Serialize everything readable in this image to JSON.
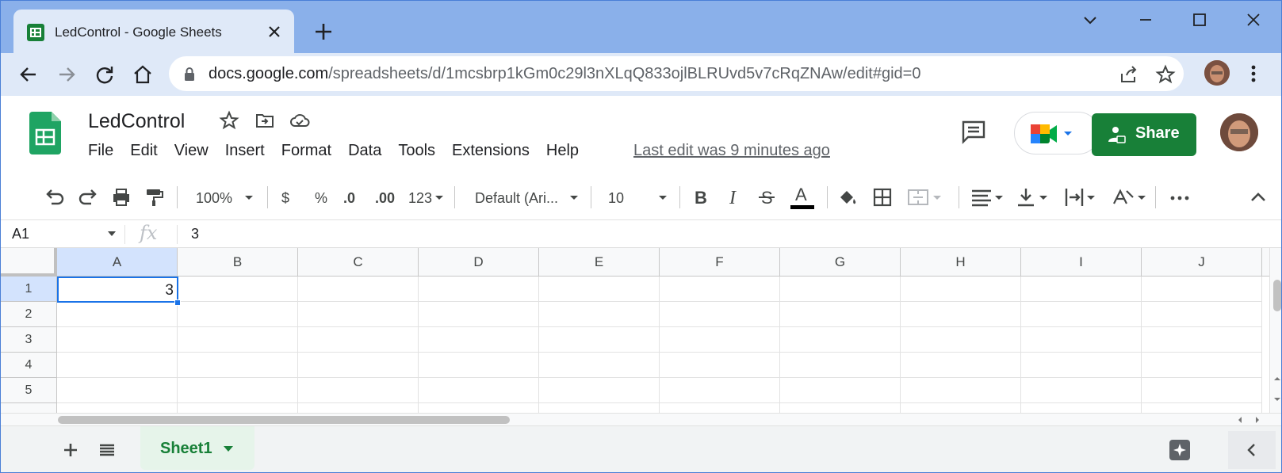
{
  "browser": {
    "tab_title": "LedControl - Google Sheets",
    "url_host": "docs.google.com",
    "url_path": "/spreadsheets/d/1mcsbrp1kGm0c29l3nXLqQ833ojlBLRUvd5v7cRqZNAw/edit#gid=0"
  },
  "doc": {
    "title": "LedControl",
    "last_edit": "Last edit was 9 minutes ago",
    "share_label": "Share"
  },
  "menu": [
    "File",
    "Edit",
    "View",
    "Insert",
    "Format",
    "Data",
    "Tools",
    "Extensions",
    "Help"
  ],
  "toolbar": {
    "zoom": "100%",
    "currency": "$",
    "percent": "%",
    "dec_decrease": ".0",
    "dec_increase": ".00",
    "more_formats": "123",
    "font": "Default (Ari...",
    "font_size": "10"
  },
  "formula_bar": {
    "name_box": "A1",
    "fx": "fx",
    "value": "3"
  },
  "grid": {
    "columns": [
      "A",
      "B",
      "C",
      "D",
      "E",
      "F",
      "G",
      "H",
      "I",
      "J"
    ],
    "rows": [
      "1",
      "2",
      "3",
      "4",
      "5"
    ],
    "cells": {
      "A1": "3"
    },
    "selected": "A1"
  },
  "sheets": [
    {
      "name": "Sheet1",
      "active": true
    }
  ],
  "colors": {
    "accent": "#188038",
    "selection": "#1a73e8",
    "tabstrip": "#8ab0ea"
  }
}
